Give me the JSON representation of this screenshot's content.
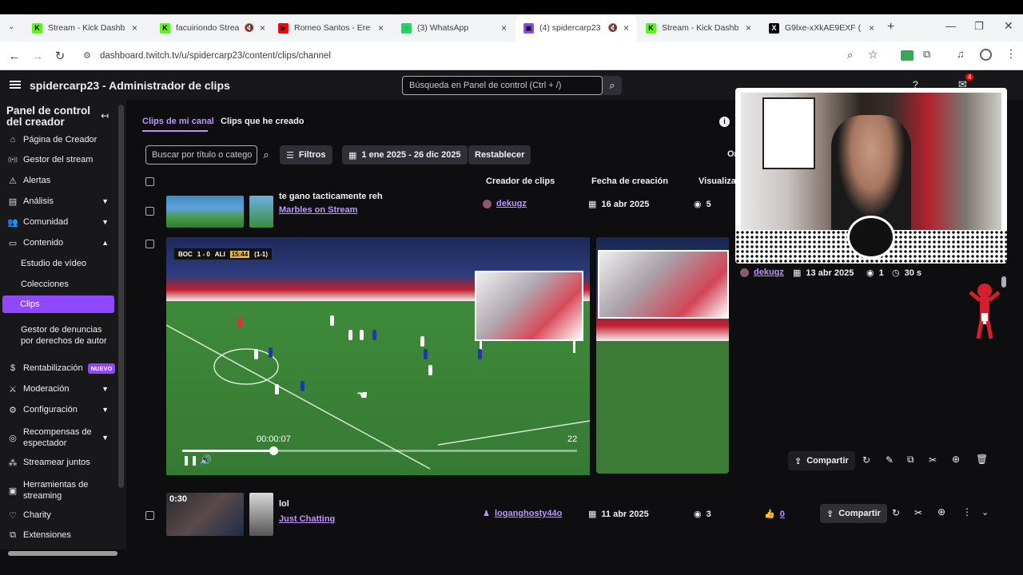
{
  "browser": {
    "tabs": [
      {
        "title": "Stream - Kick Dashboard",
        "icon": "kick-icon",
        "color": "#53fc18",
        "muted": false,
        "active": false
      },
      {
        "title": "facuiriondo Stream",
        "icon": "kick-icon",
        "color": "#53fc18",
        "muted": true,
        "active": false
      },
      {
        "title": "Romeo Santos - Eres M",
        "icon": "youtube-icon",
        "color": "#ff0000",
        "muted": false,
        "active": false
      },
      {
        "title": "(3) WhatsApp",
        "icon": "whatsapp-icon",
        "color": "#25d366",
        "muted": false,
        "active": false
      },
      {
        "title": "(4) spidercarp23 - ",
        "icon": "twitch-icon",
        "color": "#9147ff",
        "muted": true,
        "active": true
      },
      {
        "title": "Stream - Kick Dashboard",
        "icon": "kick-icon",
        "color": "#53fc18",
        "muted": false,
        "active": false
      },
      {
        "title": "G9lxe-xXkAE9EXF (102",
        "icon": "x-icon",
        "color": "#000000",
        "muted": false,
        "active": false
      }
    ],
    "url": "dashboard.twitch.tv/u/spidercarp23/content/clips/channel"
  },
  "header": {
    "title": "spidercarp23 - Administrador de clips",
    "search_placeholder": "Búsqueda en Panel de control (Ctrl + /)",
    "notification_count": "4"
  },
  "sidebar": {
    "heading": "Panel de control del creador",
    "items": [
      {
        "label": "Página de Creador",
        "icon": "home-icon",
        "chevron": "",
        "level": 0
      },
      {
        "label": "Gestor del stream",
        "icon": "broadcast-icon",
        "chevron": "",
        "level": 0
      },
      {
        "label": "Alertas",
        "icon": "alert-icon",
        "chevron": "",
        "level": 0
      },
      {
        "label": "Análisis",
        "icon": "chart-icon",
        "chevron": "down",
        "level": 0
      },
      {
        "label": "Comunidad",
        "icon": "community-icon",
        "chevron": "down",
        "level": 0
      },
      {
        "label": "Contenido",
        "icon": "content-icon",
        "chevron": "up",
        "level": 0
      },
      {
        "label": "Estudio de vídeo",
        "icon": "",
        "chevron": "",
        "level": 1
      },
      {
        "label": "Colecciones",
        "icon": "",
        "chevron": "",
        "level": 1
      },
      {
        "label": "Clips",
        "icon": "",
        "chevron": "",
        "level": 1,
        "active": true
      },
      {
        "label": "Gestor de denuncias por derechos de autor",
        "icon": "",
        "chevron": "",
        "level": 1
      },
      {
        "label": "Rentabilización",
        "icon": "money-icon",
        "chevron": "",
        "level": 0,
        "badge": "NUEVO"
      },
      {
        "label": "Moderación",
        "icon": "sword-icon",
        "chevron": "down",
        "level": 0
      },
      {
        "label": "Configuración",
        "icon": "gear-icon",
        "chevron": "down",
        "level": 0
      },
      {
        "label": "Recompensas de espectador",
        "icon": "reward-icon",
        "chevron": "down",
        "level": 0
      },
      {
        "label": "Streamear juntos",
        "icon": "together-icon",
        "chevron": "",
        "level": 0
      },
      {
        "label": "Herramientas de streaming",
        "icon": "tools-icon",
        "chevron": "",
        "level": 0
      },
      {
        "label": "Charity",
        "icon": "heart-icon",
        "chevron": "",
        "level": 0
      },
      {
        "label": "Extensiones",
        "icon": "extension-icon",
        "chevron": "",
        "level": 0
      }
    ]
  },
  "main": {
    "tabs": [
      "Clips de mi canal",
      "Clips que he creado"
    ],
    "search_placeholder": "Buscar por título o catego",
    "filters_label": "Filtros",
    "date_range": "1 ene 2025 - 26 dic 2025",
    "reset_label": "Restablecer",
    "order_label": "Or",
    "columns": [
      "Creador de clips",
      "Fecha de creación",
      "Visualiza"
    ],
    "rows": [
      {
        "title": "te gano tacticamente reh",
        "category": "Marbles on Stream",
        "creator": "dekugz",
        "date": "16 abr 2025",
        "views": "5"
      },
      {
        "title": "",
        "category": "",
        "creator": "dekugz",
        "date": "13 abr 2025",
        "views": "1",
        "duration": "30 s",
        "share": "Compartir"
      },
      {
        "title": "lol",
        "category": "Just Chatting",
        "creator": "loganghosty44o",
        "date": "11 abr 2025",
        "views": "3",
        "likes": "0",
        "thumb_time": "0:30",
        "share": "Compartir"
      }
    ],
    "player": {
      "time": "00:00:07",
      "count": "22",
      "progress": 0.23,
      "scoreboard": {
        "home": "BOC",
        "score": "1 - 0",
        "away": "ALI",
        "clock": "15:44",
        "agg": "(1-1)"
      }
    }
  },
  "colors": {
    "accent": "#9147ff",
    "link": "#bf94ff",
    "bg": "#0e0e10",
    "panel": "#18181b"
  }
}
